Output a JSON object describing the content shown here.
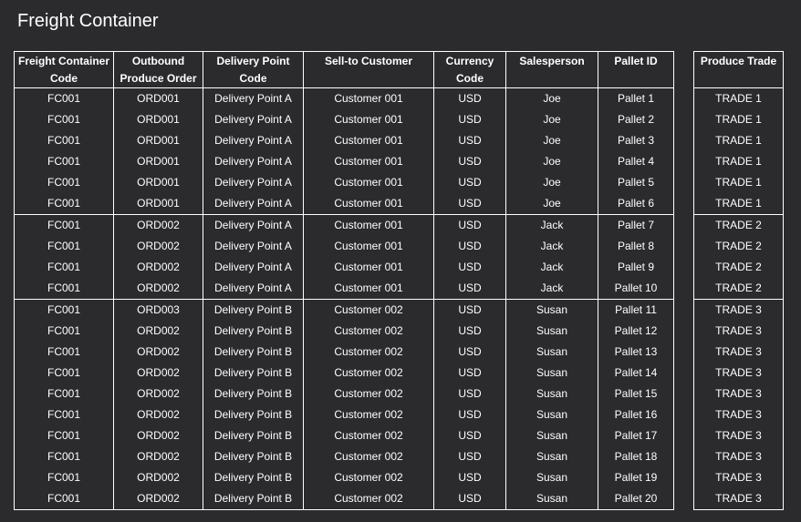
{
  "title": "Freight Container",
  "main_table": {
    "headers": [
      "Freight Container Code",
      "Outbound Produce Order",
      "Delivery Point Code",
      "Sell-to Customer",
      "Currency Code",
      "Salesperson",
      "Pallet ID"
    ],
    "header_lines": [
      [
        "Freight Container",
        "Code"
      ],
      [
        "Outbound",
        "Produce Order"
      ],
      [
        "Delivery Point",
        "Code"
      ],
      [
        "Sell-to Customer",
        ""
      ],
      [
        "Currency",
        "Code"
      ],
      [
        "Salesperson",
        ""
      ],
      [
        "Pallet ID",
        ""
      ]
    ],
    "rows": [
      [
        "FC001",
        "ORD001",
        "Delivery Point A",
        "Customer 001",
        "USD",
        "Joe",
        "Pallet 1"
      ],
      [
        "FC001",
        "ORD001",
        "Delivery Point A",
        "Customer 001",
        "USD",
        "Joe",
        "Pallet 2"
      ],
      [
        "FC001",
        "ORD001",
        "Delivery Point A",
        "Customer 001",
        "USD",
        "Joe",
        "Pallet 3"
      ],
      [
        "FC001",
        "ORD001",
        "Delivery Point A",
        "Customer 001",
        "USD",
        "Joe",
        "Pallet 4"
      ],
      [
        "FC001",
        "ORD001",
        "Delivery Point A",
        "Customer 001",
        "USD",
        "Joe",
        "Pallet 5"
      ],
      [
        "FC001",
        "ORD001",
        "Delivery Point A",
        "Customer 001",
        "USD",
        "Joe",
        "Pallet 6"
      ],
      [
        "FC001",
        "ORD002",
        "Delivery Point A",
        "Customer 001",
        "USD",
        "Jack",
        "Pallet 7"
      ],
      [
        "FC001",
        "ORD002",
        "Delivery Point A",
        "Customer 001",
        "USD",
        "Jack",
        "Pallet 8"
      ],
      [
        "FC001",
        "ORD002",
        "Delivery Point A",
        "Customer 001",
        "USD",
        "Jack",
        "Pallet 9"
      ],
      [
        "FC001",
        "ORD002",
        "Delivery Point A",
        "Customer 001",
        "USD",
        "Jack",
        "Pallet 10"
      ],
      [
        "FC001",
        "ORD003",
        "Delivery Point B",
        "Customer 002",
        "USD",
        "Susan",
        "Pallet 11"
      ],
      [
        "FC001",
        "ORD002",
        "Delivery Point B",
        "Customer 002",
        "USD",
        "Susan",
        "Pallet 12"
      ],
      [
        "FC001",
        "ORD002",
        "Delivery Point B",
        "Customer 002",
        "USD",
        "Susan",
        "Pallet 13"
      ],
      [
        "FC001",
        "ORD002",
        "Delivery Point B",
        "Customer 002",
        "USD",
        "Susan",
        "Pallet 14"
      ],
      [
        "FC001",
        "ORD002",
        "Delivery Point B",
        "Customer 002",
        "USD",
        "Susan",
        "Pallet 15"
      ],
      [
        "FC001",
        "ORD002",
        "Delivery Point B",
        "Customer 002",
        "USD",
        "Susan",
        "Pallet 16"
      ],
      [
        "FC001",
        "ORD002",
        "Delivery Point B",
        "Customer 002",
        "USD",
        "Susan",
        "Pallet 17"
      ],
      [
        "FC001",
        "ORD002",
        "Delivery Point B",
        "Customer 002",
        "USD",
        "Susan",
        "Pallet 18"
      ],
      [
        "FC001",
        "ORD002",
        "Delivery Point B",
        "Customer 002",
        "USD",
        "Susan",
        "Pallet 19"
      ],
      [
        "FC001",
        "ORD002",
        "Delivery Point B",
        "Customer 002",
        "USD",
        "Susan",
        "Pallet 20"
      ]
    ]
  },
  "trade_table": {
    "header": "Produce Trade",
    "rows": [
      "TRADE 1",
      "TRADE 1",
      "TRADE 1",
      "TRADE 1",
      "TRADE 1",
      "TRADE 1",
      "TRADE 2",
      "TRADE 2",
      "TRADE 2",
      "TRADE 2",
      "TRADE 3",
      "TRADE 3",
      "TRADE 3",
      "TRADE 3",
      "TRADE 3",
      "TRADE 3",
      "TRADE 3",
      "TRADE 3",
      "TRADE 3",
      "TRADE 3"
    ]
  },
  "group_boundaries_after_row": [
    6,
    10
  ],
  "colors": {
    "background": "#2b2b2e",
    "text": "#ffffff",
    "border": "#ffffff"
  }
}
